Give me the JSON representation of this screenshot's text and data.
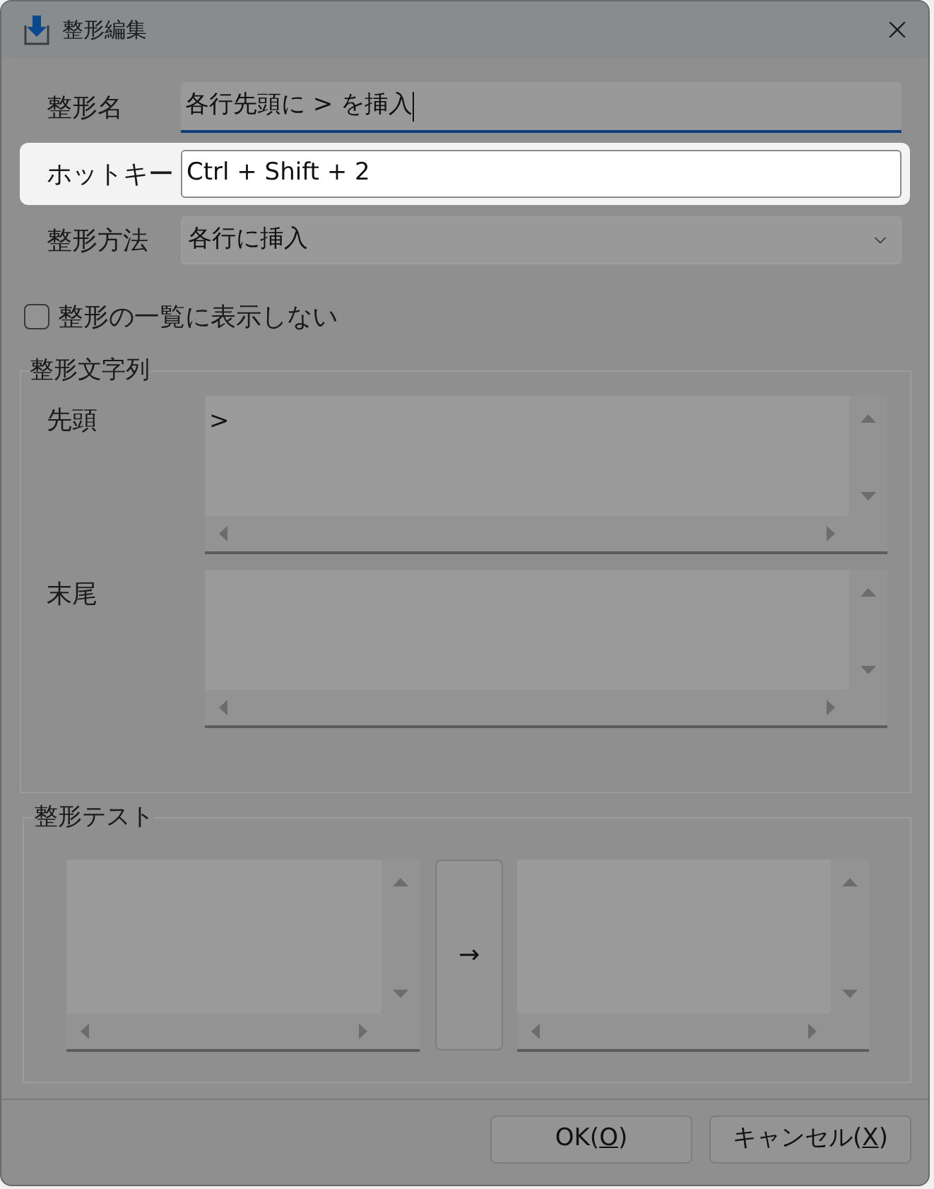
{
  "window": {
    "title": "整形編集"
  },
  "fields": [
    {
      "kind": "text",
      "label": "整形名",
      "value": "各行先頭に > を挿入",
      "focused": true,
      "highlighted": false
    },
    {
      "kind": "text",
      "label": "ホットキー",
      "value": "Ctrl + Shift + 2",
      "focused": false,
      "highlighted": true
    },
    {
      "kind": "dropdown",
      "label": "整形方法",
      "value": "各行に挿入",
      "focused": false,
      "highlighted": false
    }
  ],
  "hide_from_list": {
    "label": "整形の一覧に表示しない",
    "checked": false
  },
  "format_strings": {
    "title": "整形文字列",
    "fields": [
      {
        "label": "先頭",
        "value": ">"
      },
      {
        "label": "末尾"
      }
    ]
  },
  "format_test": {
    "title": "整形テスト",
    "convert_button": "→"
  },
  "buttons": [
    {
      "text_before": "OK(",
      "accelerator": "O",
      "text_after": ")"
    },
    {
      "text_before": "キャンセル(",
      "accelerator": "X",
      "text_after": ")"
    }
  ]
}
